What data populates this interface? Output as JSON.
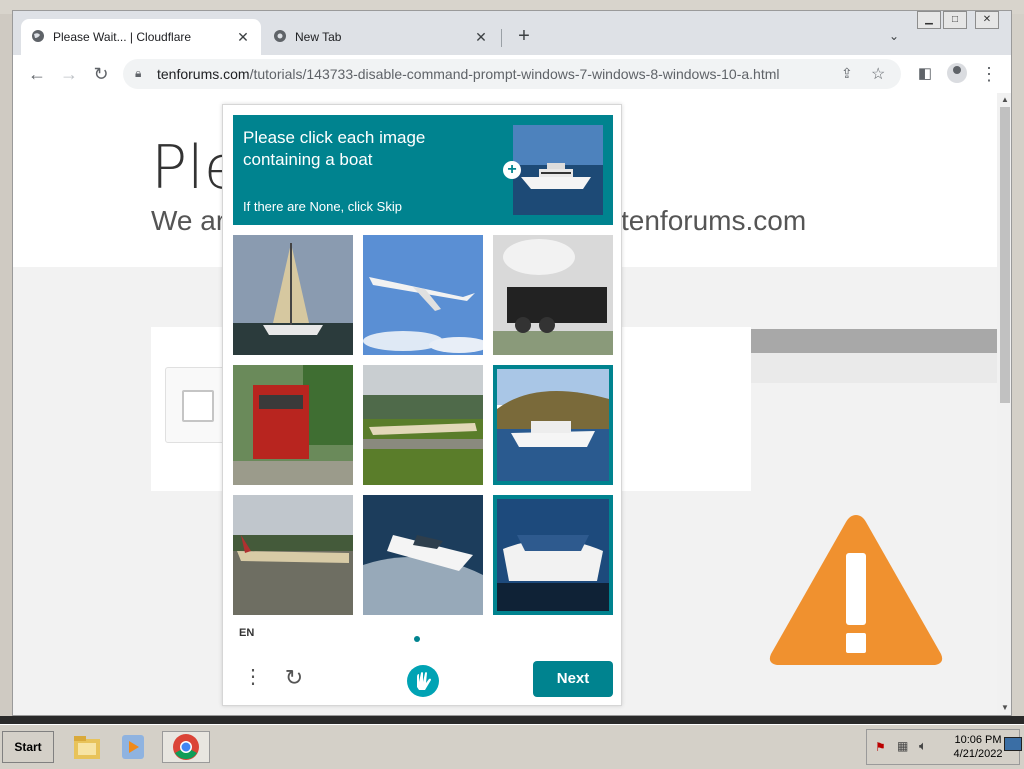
{
  "browser": {
    "tabs": [
      {
        "title": "Please Wait... | Cloudflare",
        "active": true
      },
      {
        "title": "New Tab",
        "active": false
      }
    ],
    "new_tab_symbol": "+",
    "url_host": "tenforums.com",
    "url_path": "/tutorials/143733-disable-command-prompt-windows-7-windows-8-windows-10-a.html"
  },
  "page": {
    "title_fragment": "Ple",
    "subtitle_fragment": "We ar",
    "subtitle_domain": "tenforums.com",
    "warning_icon_color": "#f0912f"
  },
  "captcha": {
    "prompt": "Please click each image containing a boat",
    "skip_hint": "If there are None, click Skip",
    "language": "EN",
    "next_label": "Next",
    "accent_color": "#00838f",
    "tiles": [
      {
        "subject": "sailboat",
        "selected": false
      },
      {
        "subject": "airplane in sky",
        "selected": false
      },
      {
        "subject": "steam train",
        "selected": false
      },
      {
        "subject": "red locomotive",
        "selected": false
      },
      {
        "subject": "airplane on runway",
        "selected": false
      },
      {
        "subject": "yacht",
        "selected": true
      },
      {
        "subject": "airliner on runway",
        "selected": false
      },
      {
        "subject": "speedboat",
        "selected": false
      },
      {
        "subject": "motorboat",
        "selected": true
      }
    ]
  },
  "taskbar": {
    "start_label": "Start",
    "time": "10:06 PM",
    "date": "4/21/2022"
  }
}
